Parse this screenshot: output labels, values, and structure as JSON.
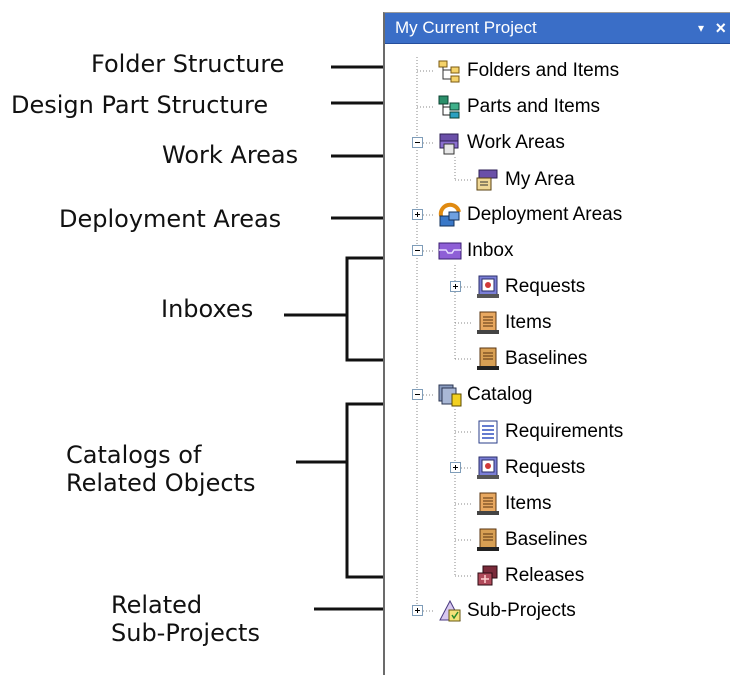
{
  "annotations": {
    "folder_structure": "Folder Structure",
    "design_part_structure": "Design Part Structure",
    "work_areas": "Work Areas",
    "deployment_areas": "Deployment Areas",
    "inboxes": "Inboxes",
    "catalogs_line1": "Catalogs of",
    "catalogs_line2": "Related Objects",
    "related_line1": "Related",
    "related_line2": "Sub-Projects"
  },
  "panel": {
    "title": "My Current Project",
    "dropdown_glyph": "▾",
    "close_glyph": "×",
    "title_bar_color": "#3a6ec7"
  },
  "tree": {
    "folders_and_items": "Folders and Items",
    "parts_and_items": "Parts and Items",
    "work_areas": "Work Areas",
    "my_area": "My Area",
    "deployment_areas": "Deployment Areas",
    "inbox": "Inbox",
    "inbox_requests": "Requests",
    "inbox_items": "Items",
    "inbox_baselines": "Baselines",
    "catalog": "Catalog",
    "catalog_requirements": "Requirements",
    "catalog_requests": "Requests",
    "catalog_items": "Items",
    "catalog_baselines": "Baselines",
    "catalog_releases": "Releases",
    "sub_projects": "Sub-Projects"
  }
}
